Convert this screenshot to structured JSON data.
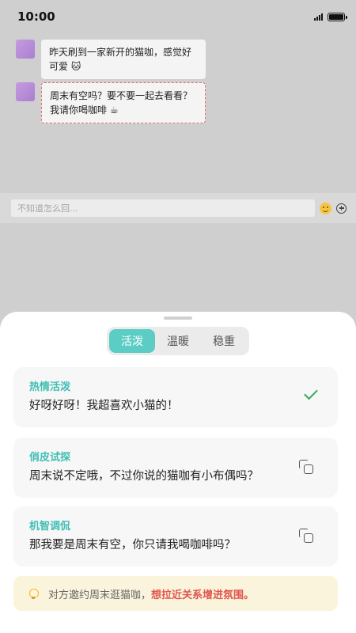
{
  "status_bar": {
    "time": "10:00"
  },
  "chat": {
    "messages": [
      {
        "text": "昨天刷到一家新开的猫咖，感觉好可爱 🐱"
      },
      {
        "text": "周末有空吗？要不要一起去看看？我请你喝咖啡 ☕"
      }
    ]
  },
  "input": {
    "placeholder": "不知道怎么回..."
  },
  "sheet": {
    "tabs": [
      {
        "label": "活泼",
        "active": true
      },
      {
        "label": "温暖",
        "active": false
      },
      {
        "label": "稳重",
        "active": false
      }
    ],
    "suggestions": [
      {
        "title": "热情活泼",
        "text": "好呀好呀！我超喜欢小猫的！",
        "icon": "check-icon"
      },
      {
        "title": "俏皮试探",
        "text": "周末说不定哦，不过你说的猫咖有小布偶吗？",
        "icon": "copy-icon"
      },
      {
        "title": "机智调侃",
        "text": "那我要是周末有空，你只请我喝咖啡吗？",
        "icon": "copy-icon"
      }
    ],
    "tip": {
      "text": "对方邀约周末逛猫咖，",
      "highlight": "想拉近关系增进氛围。"
    }
  },
  "colors": {
    "accent": "#5ccdc5",
    "title": "#3fbeb4",
    "check": "#3aaa60",
    "highlight": "#e0564d",
    "tip_bg": "#fbf4dc"
  }
}
